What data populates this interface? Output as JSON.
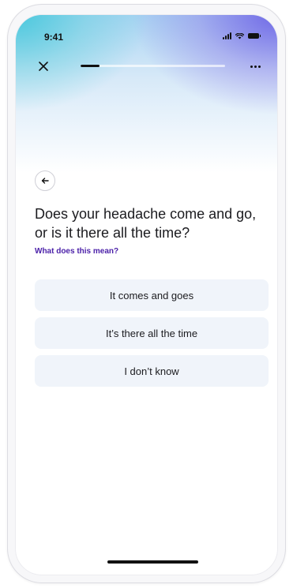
{
  "status_bar": {
    "time": "9:41"
  },
  "header": {
    "progress_percent": 13,
    "close_icon": "close-icon",
    "more_icon": "more-horizontal-icon"
  },
  "back_icon": "arrow-left-icon",
  "question": {
    "text": "Does your headache come and go, or is it there all the time?",
    "help_link": "What does this mean?"
  },
  "options": [
    {
      "label": "It comes and goes"
    },
    {
      "label": "It’s there all the time"
    },
    {
      "label": "I don’t know"
    }
  ],
  "colors": {
    "link": "#4a1fa8",
    "option_bg": "#f0f4fa",
    "text": "#1b1b1f"
  }
}
